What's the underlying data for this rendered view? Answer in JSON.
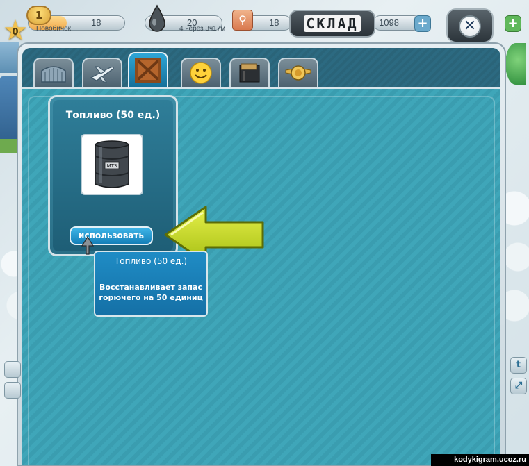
{
  "hud": {
    "level": "1",
    "xp_value": "18",
    "xp_stars": "0",
    "xp_sub": "Новобичок",
    "fuel_value": "20",
    "fuel_sub": "4 через 3ч17м",
    "passengers_value": "18",
    "coins_value": "1098"
  },
  "window": {
    "title": "СКЛАД",
    "tabs": [
      "hangar",
      "planes",
      "storage",
      "smileys",
      "documents",
      "emblem"
    ],
    "active_tab": "storage"
  },
  "item": {
    "title": "Топливо (50 ед.)",
    "barrel_label": "МТЗ",
    "use_button": "использовать"
  },
  "tooltip": {
    "title": "Топливо (50 ед.)",
    "description_line1": "Восстанавливает запас",
    "description_line2": "горючего на 50 единиц"
  },
  "watermark": "kodykigram.ucoz.ru",
  "colors": {
    "accent_green": "#c8dc2a",
    "panel_teal": "#3fa6b9",
    "button_blue": "#1f8cc5"
  }
}
